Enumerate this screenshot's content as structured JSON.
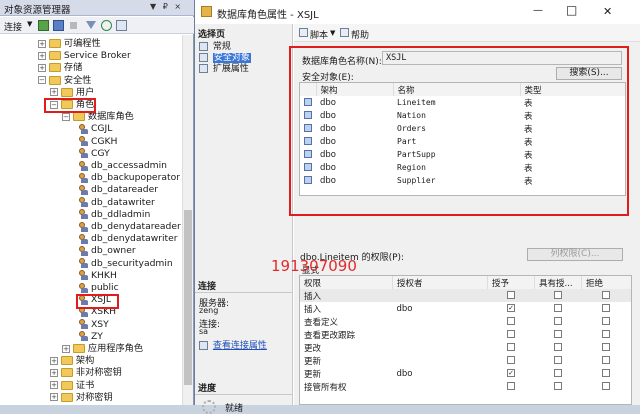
{
  "explorer": {
    "title": "对象资源管理器",
    "title_icons": "▼ ₽ ×",
    "toolbar_connect": "连接",
    "tree": [
      {
        "label": "可编程性",
        "kind": "folder",
        "level": 2,
        "exp": "+"
      },
      {
        "label": "Service Broker",
        "kind": "folder",
        "level": 2,
        "exp": "+"
      },
      {
        "label": "存储",
        "kind": "folder",
        "level": 2,
        "exp": "+"
      },
      {
        "label": "安全性",
        "kind": "folder",
        "level": 2,
        "exp": "-"
      },
      {
        "label": "用户",
        "kind": "folder",
        "level": 3,
        "exp": "+"
      },
      {
        "label": "角色",
        "kind": "folder",
        "level": 3,
        "exp": "-"
      },
      {
        "label": "数据库角色",
        "kind": "folder",
        "level": 4,
        "exp": "-"
      },
      {
        "label": "CGJL",
        "kind": "role",
        "level": 5
      },
      {
        "label": "CGKH",
        "kind": "role",
        "level": 5
      },
      {
        "label": "CGY",
        "kind": "role",
        "level": 5
      },
      {
        "label": "db_accessadmin",
        "kind": "role",
        "level": 5
      },
      {
        "label": "db_backupoperator",
        "kind": "role",
        "level": 5
      },
      {
        "label": "db_datareader",
        "kind": "role",
        "level": 5
      },
      {
        "label": "db_datawriter",
        "kind": "role",
        "level": 5
      },
      {
        "label": "db_ddladmin",
        "kind": "role",
        "level": 5
      },
      {
        "label": "db_denydatareader",
        "kind": "role",
        "level": 5
      },
      {
        "label": "db_denydatawriter",
        "kind": "role",
        "level": 5
      },
      {
        "label": "db_owner",
        "kind": "role",
        "level": 5
      },
      {
        "label": "db_securityadmin",
        "kind": "role",
        "level": 5
      },
      {
        "label": "KHKH",
        "kind": "role",
        "level": 5
      },
      {
        "label": "public",
        "kind": "role",
        "level": 5
      },
      {
        "label": "XSJL",
        "kind": "role",
        "level": 5
      },
      {
        "label": "XSKH",
        "kind": "role",
        "level": 5
      },
      {
        "label": "XSY",
        "kind": "role",
        "level": 5
      },
      {
        "label": "ZY",
        "kind": "role",
        "level": 5
      },
      {
        "label": "应用程序角色",
        "kind": "folder",
        "level": 4,
        "exp": "+"
      },
      {
        "label": "架构",
        "kind": "folder",
        "level": 3,
        "exp": "+"
      },
      {
        "label": "非对称密钥",
        "kind": "folder",
        "level": 3,
        "exp": "+"
      },
      {
        "label": "证书",
        "kind": "folder",
        "level": 3,
        "exp": "+"
      },
      {
        "label": "对称密钥",
        "kind": "folder",
        "level": 3,
        "exp": "+"
      }
    ]
  },
  "dialog": {
    "title": "数据库角色属性 - XSJL",
    "min": "—",
    "max": "□",
    "close": "✕",
    "select_page_header": "选择页",
    "pages": [
      "常规",
      "安全对象",
      "扩展属性"
    ],
    "toolbar_script": "脚本",
    "toolbar_help": "帮助",
    "role_name_label": "数据库角色名称(N):",
    "role_name_value": "XSJL",
    "securables_label": "安全对象(E):",
    "search_button": "搜索(S)...",
    "securables_headers": [
      "架构",
      "名称",
      "类型"
    ],
    "securables": [
      {
        "schema": "dbo",
        "name": "Lineitem",
        "type": "表"
      },
      {
        "schema": "dbo",
        "name": "Nation",
        "type": "表"
      },
      {
        "schema": "dbo",
        "name": "Orders",
        "type": "表"
      },
      {
        "schema": "dbo",
        "name": "Part",
        "type": "表"
      },
      {
        "schema": "dbo",
        "name": "PartSupp",
        "type": "表"
      },
      {
        "schema": "dbo",
        "name": "Region",
        "type": "表"
      },
      {
        "schema": "dbo",
        "name": "Supplier",
        "type": "表"
      }
    ],
    "perm_label": "dbo.Lineitem 的权限(P):",
    "column_perm_button": "列权限(C)...",
    "perm_tab": "显式",
    "perm_headers": [
      "权限",
      "授权者",
      "授予",
      "具有授...",
      "拒绝"
    ],
    "permissions": [
      {
        "name": "插入",
        "grantor": "",
        "grant": false,
        "with": false,
        "deny": false
      },
      {
        "name": "插入",
        "grantor": "dbo",
        "grant": true,
        "with": false,
        "deny": false
      },
      {
        "name": "查看定义",
        "grantor": "",
        "grant": false,
        "with": false,
        "deny": false
      },
      {
        "name": "查看更改跟踪",
        "grantor": "",
        "grant": false,
        "with": false,
        "deny": false
      },
      {
        "name": "更改",
        "grantor": "",
        "grant": false,
        "with": false,
        "deny": false
      },
      {
        "name": "更新",
        "grantor": "",
        "grant": false,
        "with": false,
        "deny": false
      },
      {
        "name": "更新",
        "grantor": "dbo",
        "grant": true,
        "with": false,
        "deny": false
      },
      {
        "name": "接管所有权",
        "grantor": "",
        "grant": false,
        "with": false,
        "deny": false
      }
    ],
    "connection_header": "连接",
    "server_label": "服务器:",
    "server_value": "zeng",
    "conn_label": "连接:",
    "conn_value": "sa",
    "view_conn_link": "查看连接属性",
    "progress_header": "进度",
    "progress_status": "就绪"
  },
  "watermark": "191307090"
}
